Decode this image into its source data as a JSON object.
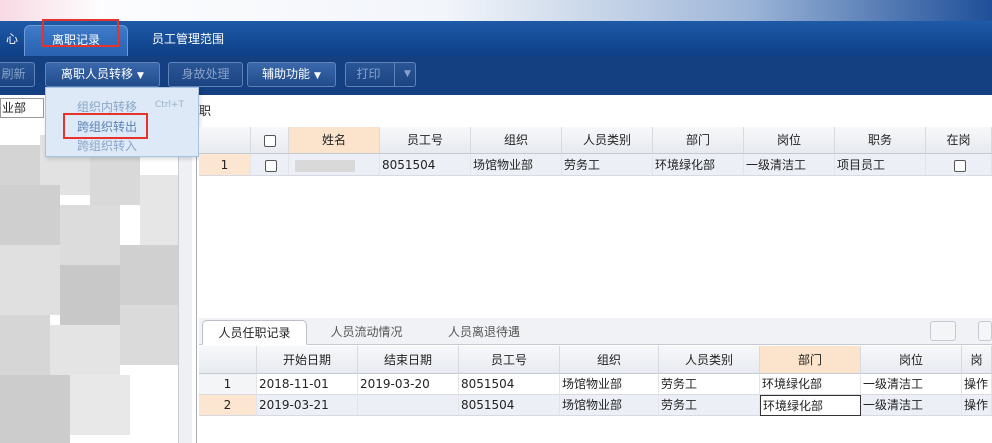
{
  "tabs": [
    {
      "label": "心"
    },
    {
      "label": "离职记录"
    },
    {
      "label": "员工管理范围"
    }
  ],
  "toolbar": {
    "refresh": "刷新",
    "transfer": "离职人员转移",
    "death": "身故处理",
    "assist": "辅助功能",
    "print": "打印"
  },
  "menu": {
    "items": [
      "组织内转移",
      "跨组织转出",
      "跨组织转入"
    ],
    "shortcut": "Ctrl+T"
  },
  "left": {
    "combo_value": "业部",
    "after_label": "职"
  },
  "grid": {
    "headers": [
      "姓名",
      "员工号",
      "组织",
      "人员类别",
      "部门",
      "岗位",
      "职务",
      "在岗"
    ],
    "rows": [
      {
        "num": "1",
        "name": "",
        "emp_no": "8051504",
        "org": "场馆物业部",
        "category": "劳务工",
        "dept": "环境绿化部",
        "post": "一级清洁工",
        "duty": "项目员工"
      }
    ]
  },
  "subtabs": [
    "人员任职记录",
    "人员流动情况",
    "人员离退待遇"
  ],
  "bgrid": {
    "headers": [
      "开始日期",
      "结束日期",
      "员工号",
      "组织",
      "人员类别",
      "部门",
      "岗位",
      "岗"
    ],
    "rows": [
      {
        "num": "1",
        "start": "2018-11-01",
        "end": "2019-03-20",
        "emp_no": "8051504",
        "org": "场馆物业部",
        "category": "劳务工",
        "dept": "环境绿化部",
        "post": "一级清洁工",
        "extra": "操作"
      },
      {
        "num": "2",
        "start": "2019-03-21",
        "end": "",
        "emp_no": "8051504",
        "org": "场馆物业部",
        "category": "劳务工",
        "dept": "环境绿化部",
        "post": "一级清洁工",
        "extra": "操作"
      }
    ]
  },
  "colors": {
    "accent": "#143f80",
    "highlight_header": "#fbe3cc",
    "red_box": "#e8332c"
  }
}
